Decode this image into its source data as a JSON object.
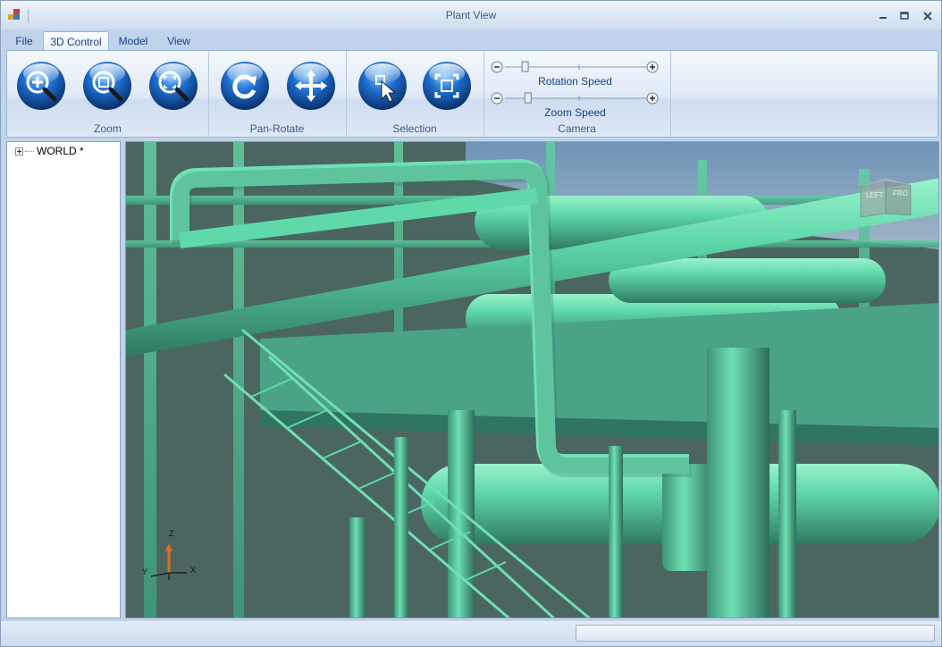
{
  "window": {
    "title": "Plant View"
  },
  "menu_tabs": [
    {
      "label": "File"
    },
    {
      "label": "3D Control"
    },
    {
      "label": "Model"
    },
    {
      "label": "View"
    }
  ],
  "ribbon": {
    "groups": [
      {
        "label": "Zoom",
        "buttons": [
          "zoom-in-icon",
          "zoom-window-icon",
          "zoom-extents-icon"
        ]
      },
      {
        "label": "Pan-Rotate",
        "buttons": [
          "rotate-icon",
          "pan-icon"
        ]
      },
      {
        "label": "Selection",
        "buttons": [
          "select-pointer-icon",
          "select-box-icon"
        ]
      },
      {
        "label": "Camera",
        "sliders": [
          {
            "label": "Rotation Speed",
            "value": 0.12
          },
          {
            "label": "Zoom Speed",
            "value": 0.14
          }
        ]
      }
    ]
  },
  "tree": {
    "root": "WORLD *"
  },
  "viewcube": {
    "left": "LEFT",
    "front": "FRO"
  },
  "axes": {
    "z": "Z",
    "y": "Y",
    "x": "X"
  },
  "colors": {
    "model": "#5fd8aa",
    "ribbon_text": "#15428b"
  }
}
